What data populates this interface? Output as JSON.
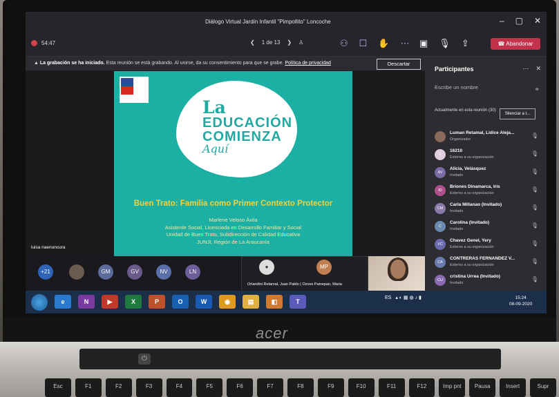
{
  "window": {
    "title": "Diálogo Virtual Jardín Infantil \"Pimpollito\" Loncoche",
    "minimize": "–",
    "maximize": "▢",
    "close": "✕"
  },
  "meeting": {
    "timer": "54:47",
    "pager": "1 de 13",
    "leave_label": "Abandonar"
  },
  "banner": {
    "lead": "La grabación se ha iniciado.",
    "body": "Esta reunión se está grabando. Al unirse, da su consentimiento para que se grabe.",
    "link": "Política de privacidad",
    "button": "Descartar"
  },
  "slide": {
    "motto": [
      "La",
      "EDUCACIÓN",
      "COMIENZA",
      "Aquí"
    ],
    "heading": "Buen Trato: Familia como Primer Contexto Protector",
    "lines": [
      "Marlene Veloso Ávila",
      "Asistente Social, Licenciada en Desarrollo Familiar y Social",
      "Unidad de Buen Trato, Subdirección de Calidad Educativa",
      "JUNJI,  Región de La Araucanía"
    ],
    "presenter": "luisa naenuncura"
  },
  "avatars": [
    {
      "initials": "+21",
      "color": "#2f63b6"
    },
    {
      "initials": "",
      "color": "#6b5a4f"
    },
    {
      "initials": "GM",
      "color": "#5b6b9a"
    },
    {
      "initials": "GV",
      "color": "#6a5a8a"
    },
    {
      "initials": "NV",
      "color": "#5a6fa8"
    },
    {
      "initials": "LN",
      "color": "#6d5e9a"
    },
    {
      "initials": "MP",
      "color": "#c17f52"
    }
  ],
  "video_caption": "Orlandini Retamal, Juan Pablo (   Ozoes Painepan, Maria",
  "participants": {
    "title": "Participantes",
    "search_placeholder": "Escribe un nombre",
    "section": "Actualmente en esta reunión (30)",
    "mute_all": "Silenciar a t...",
    "list": [
      {
        "initials": "",
        "color": "#8a6a5a",
        "name": "Luman Retamal, Lidice Aleja...",
        "role": "Organizador"
      },
      {
        "initials": "1",
        "color": "#e0cde0",
        "name": "16210",
        "role": "Externo a su organización"
      },
      {
        "initials": "AV",
        "color": "#7a6aa8",
        "name": "Alicia, Velásquez",
        "role": "Invitado"
      },
      {
        "initials": "ID",
        "color": "#b0508a",
        "name": "Briones Dinamarca, Iris",
        "role": "Externo a su organización"
      },
      {
        "initials": "CM",
        "color": "#8a7aa8",
        "name": "Carla Millanao (Invitado)",
        "role": "Invitado"
      },
      {
        "initials": "C",
        "color": "#6a8ab0",
        "name": "Carolina (Invitado)",
        "role": "Invitado"
      },
      {
        "initials": "VC",
        "color": "#6a6ab0",
        "name": "Chavez Genel, Yery",
        "role": "Externo a su organización"
      },
      {
        "initials": "CA",
        "color": "#6a7ab0",
        "name": "CONTRERAS FERNANDEZ V...",
        "role": "Externo a su organización"
      },
      {
        "initials": "CU",
        "color": "#8a6ab0",
        "name": "cristina Urrea (Invitado)",
        "role": "Invitado"
      }
    ]
  },
  "taskbar": {
    "apps": [
      {
        "label": "e",
        "color": "#2a7ad0"
      },
      {
        "label": "N",
        "color": "#7a3aa0"
      },
      {
        "label": "▶",
        "color": "#c0392b"
      },
      {
        "label": "X",
        "color": "#1e7a40"
      },
      {
        "label": "P",
        "color": "#c0502b"
      },
      {
        "label": "O",
        "color": "#1a60b0"
      },
      {
        "label": "W",
        "color": "#1a5ab0"
      },
      {
        "label": "◉",
        "color": "#e09a20"
      },
      {
        "label": "▤",
        "color": "#e0b040"
      },
      {
        "label": "◧",
        "color": "#d07a30"
      },
      {
        "label": "T",
        "color": "#5a5ab8"
      }
    ],
    "tray_lang": "ES",
    "time": "15:24",
    "date": "08-09-2020"
  },
  "laptop": {
    "brand": "acer",
    "keys": [
      "Esc",
      "F1",
      "F2",
      "F3",
      "F4",
      "F5",
      "F6",
      "F7",
      "F8",
      "F9",
      "F10",
      "F11",
      "F12",
      "Imp pnt",
      "Pausa",
      "Insert",
      "Supr"
    ]
  }
}
